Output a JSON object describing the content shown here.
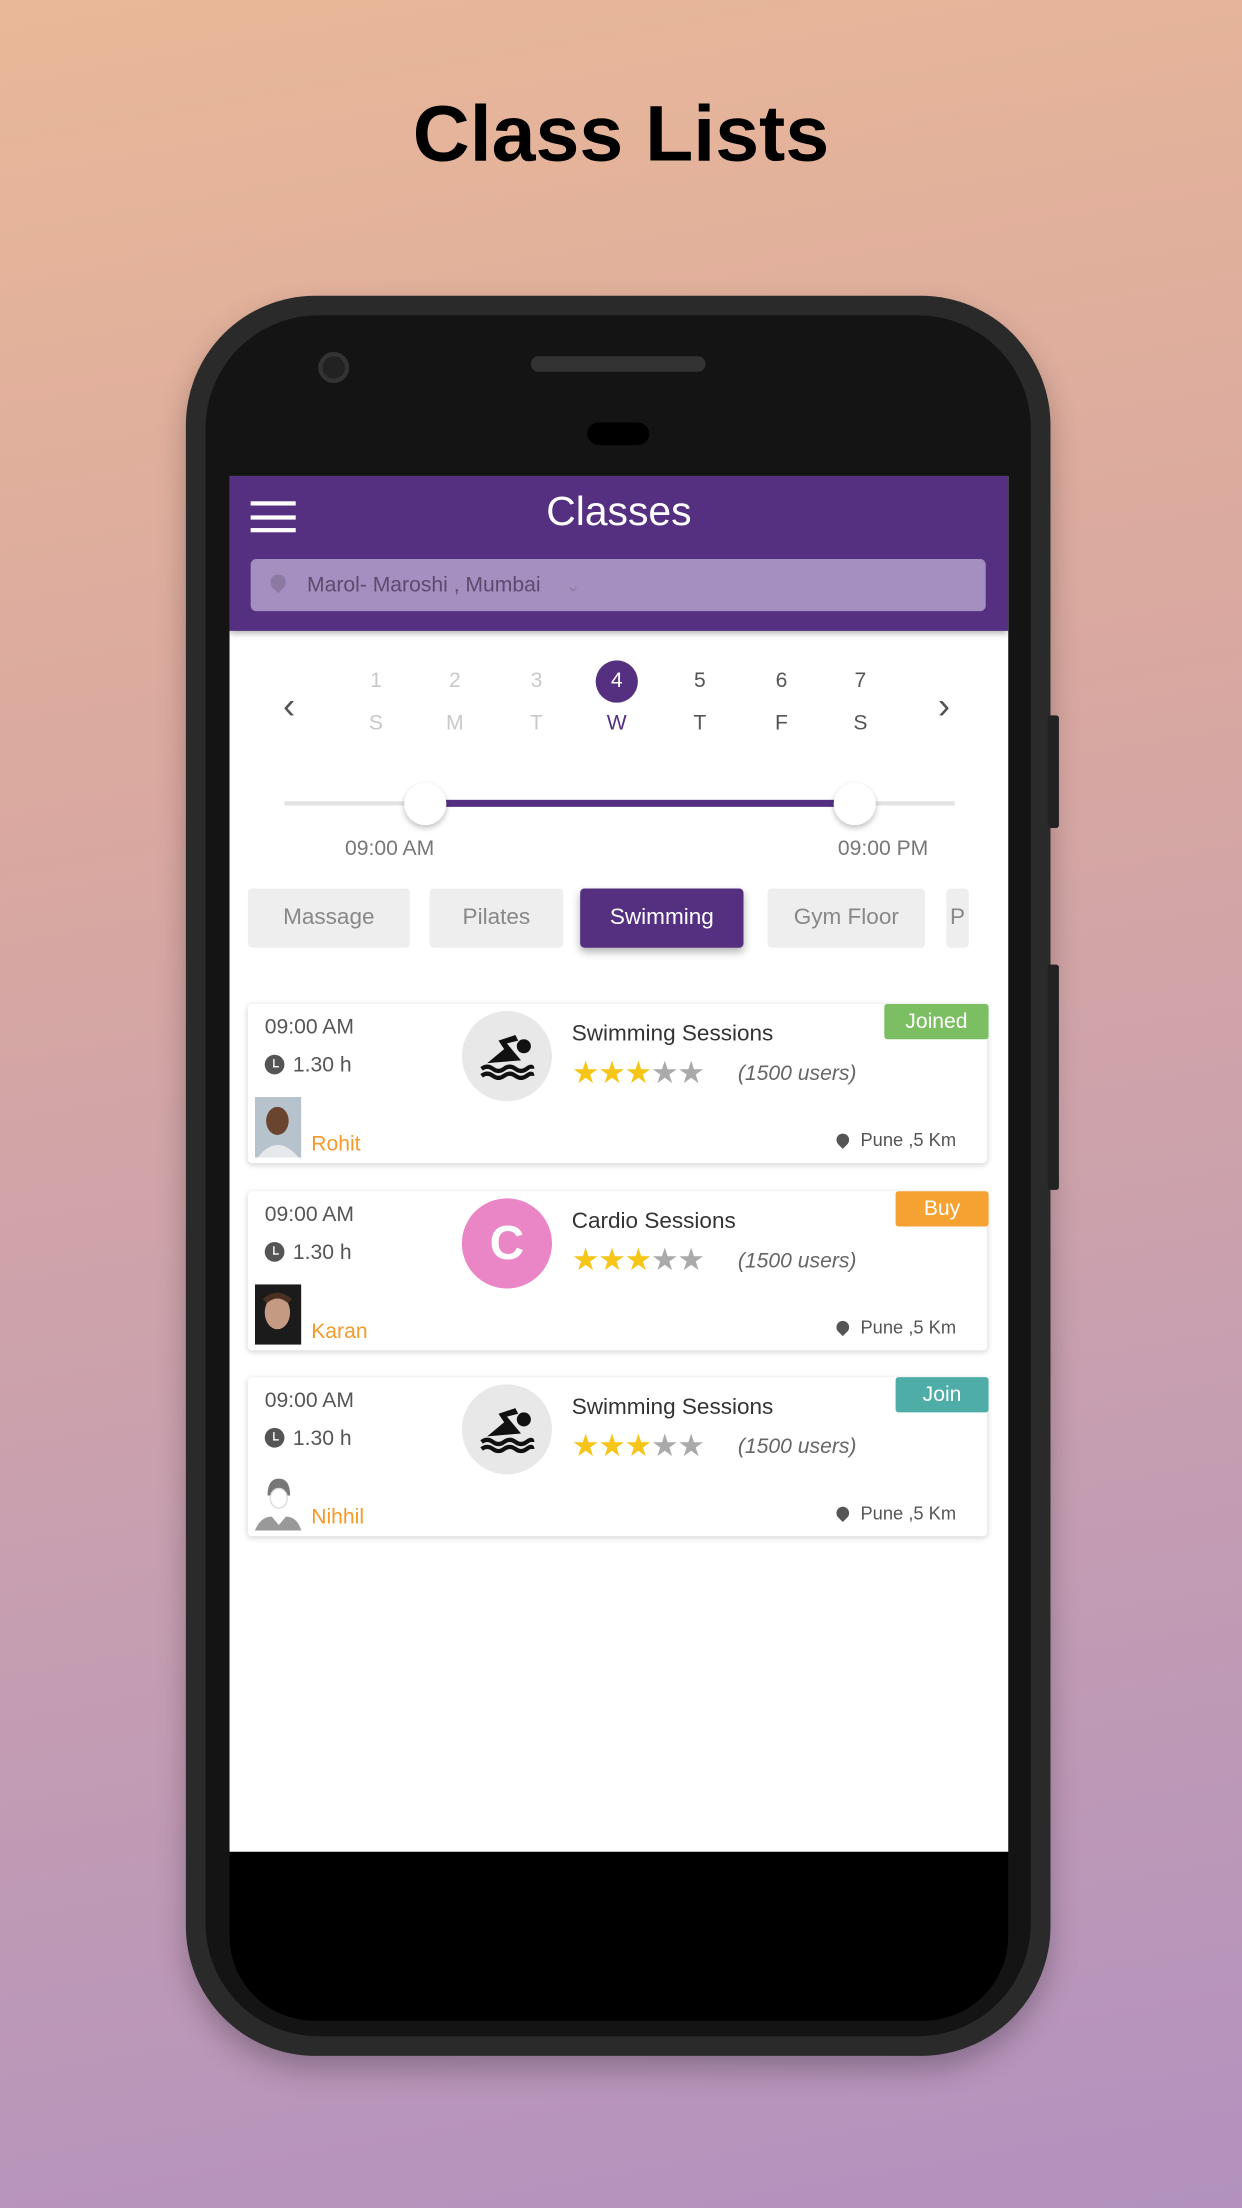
{
  "page_title": "Class Lists",
  "header": {
    "title": "Classes",
    "location": "Marol- Maroshi , Mumbai"
  },
  "colors": {
    "primary": "#553080",
    "joined": "#7cbf63",
    "buy": "#f6a232",
    "join": "#4fada8",
    "trainer_name": "#f39a2a"
  },
  "calendar": {
    "days": [
      {
        "num": "1",
        "letter": "S",
        "state": "past"
      },
      {
        "num": "2",
        "letter": "M",
        "state": "past"
      },
      {
        "num": "3",
        "letter": "T",
        "state": "past"
      },
      {
        "num": "4",
        "letter": "W",
        "state": "selected"
      },
      {
        "num": "5",
        "letter": "T",
        "state": "future"
      },
      {
        "num": "6",
        "letter": "F",
        "state": "future"
      },
      {
        "num": "7",
        "letter": "S",
        "state": "future"
      }
    ]
  },
  "time_range": {
    "start": "09:00 AM",
    "end": "09:00 PM"
  },
  "categories": [
    {
      "label": "Massage",
      "active": false
    },
    {
      "label": "Pilates",
      "active": false
    },
    {
      "label": "Swimming",
      "active": true
    },
    {
      "label": "Gym Floor",
      "active": false
    },
    {
      "label": "P",
      "active": false
    }
  ],
  "classes": [
    {
      "time": "09:00 AM",
      "duration": "1.30 h",
      "trainer": "Rohit",
      "icon": "swimmer-icon",
      "title": "Swimming Sessions",
      "rating": 3,
      "max_rating": 5,
      "users": "(1500 users)",
      "badge": "Joined",
      "location": "Pune ,5 Km"
    },
    {
      "time": "09:00 AM",
      "duration": "1.30 h",
      "trainer": "Karan",
      "icon": "letter-c",
      "icon_letter": "C",
      "title": "Cardio Sessions",
      "rating": 3,
      "max_rating": 5,
      "users": "(1500 users)",
      "badge": "Buy",
      "location": "Pune ,5 Km"
    },
    {
      "time": "09:00 AM",
      "duration": "1.30 h",
      "trainer": "Nihhil",
      "icon": "swimmer-icon",
      "title": "Swimming Sessions",
      "rating": 3,
      "max_rating": 5,
      "users": "(1500 users)",
      "badge": "Join",
      "location": "Pune ,5 Km"
    }
  ]
}
